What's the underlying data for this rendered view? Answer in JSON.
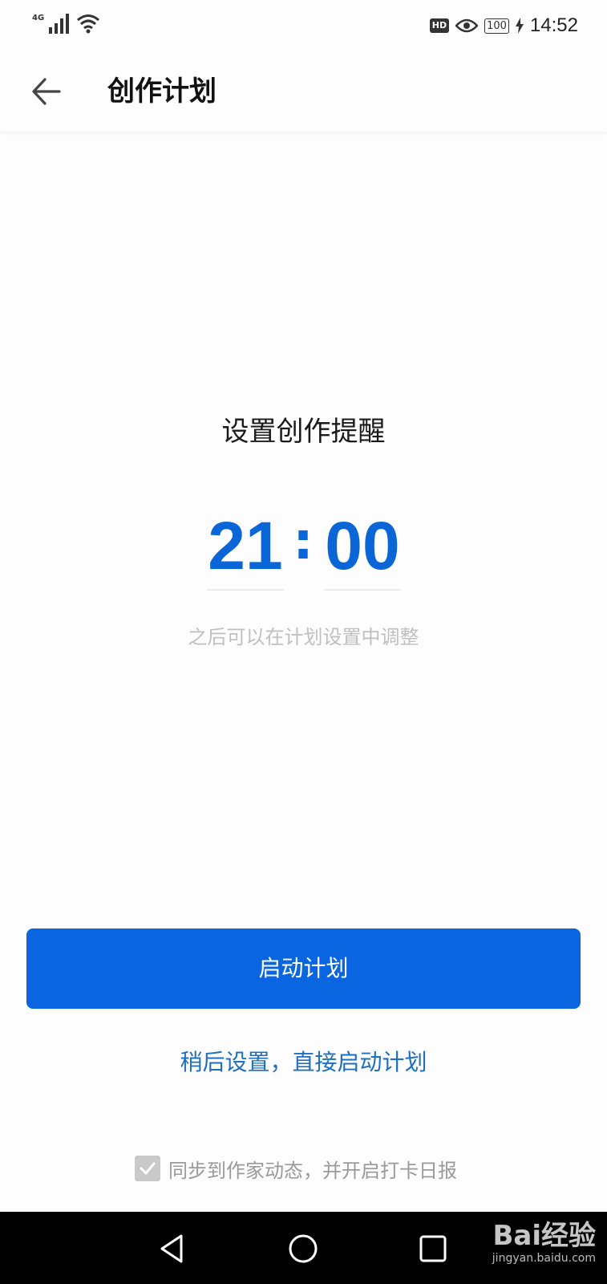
{
  "status_bar": {
    "network": "4G",
    "icons": [
      "signal-icon",
      "wifi-icon",
      "hd-icon",
      "eye-icon",
      "battery-icon",
      "charging-icon"
    ],
    "hd": "HD",
    "battery": "100",
    "time": "14:52"
  },
  "app_bar": {
    "back_icon": "arrow-left-icon",
    "title": "创作计划"
  },
  "reminder": {
    "title": "设置创作提醒",
    "hour": "21",
    "separator": ":",
    "minute": "00",
    "hint": "之后可以在计划设置中调整"
  },
  "actions": {
    "start_label": "启动计划",
    "later_label": "稍后设置，直接启动计划"
  },
  "sync": {
    "checked": true,
    "label": "同步到作家动态，并开启打卡日报"
  },
  "colors": {
    "accent": "#0a66e0",
    "time_digits": "#0a66d6",
    "link": "#1e6fbf"
  },
  "nav_bar": {
    "icons": [
      "nav-back-icon",
      "nav-home-icon",
      "nav-recents-icon"
    ]
  },
  "watermark": {
    "main": "Bai经验",
    "sub": "jingyan.baidu.com"
  }
}
